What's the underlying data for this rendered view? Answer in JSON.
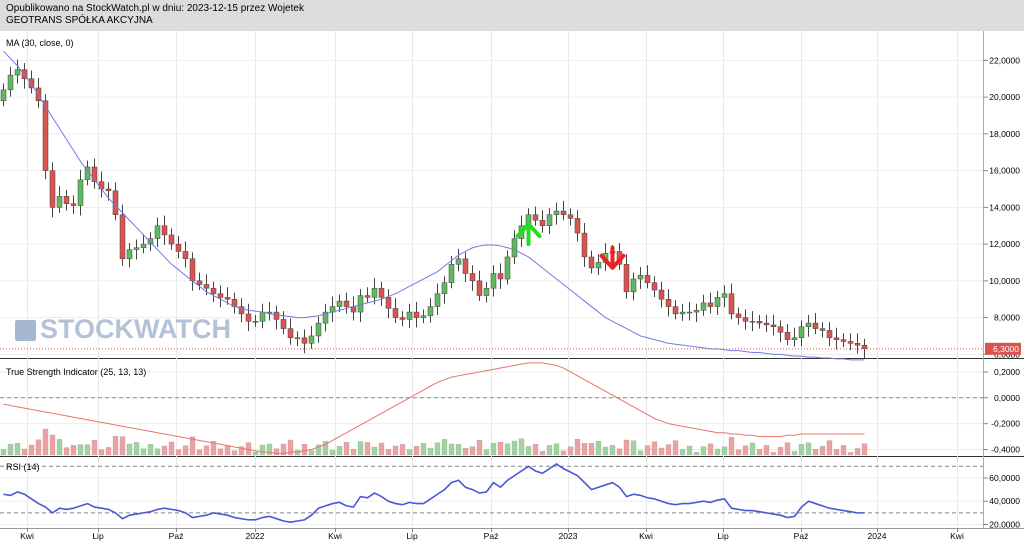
{
  "header": {
    "line1": "Opublikowano na StockWatch.pl w dniu: 2023-12-15 przez Wojetek",
    "line2": "GEOTRANS SPÓŁKA AKCYJNA"
  },
  "watermark": "STOCKWATCH",
  "colors": {
    "up": "#5fb95f",
    "down": "#d9534f",
    "ma": "#6f7ce0",
    "tsi": "#e8736a",
    "rsi": "#4a57d6",
    "last_price_badge": "#d9534f",
    "buy_arrow": "#22dd22",
    "sell_arrow": "#ee2222"
  },
  "chart_data": [
    {
      "type": "candlestick",
      "title": "MA (30, close, 0)",
      "ylim": [
        5.8,
        23.6
      ],
      "yticks": [
        "22,0000",
        "20,0000",
        "18,0000",
        "16,0000",
        "14,0000",
        "12,0000",
        "10,0000",
        "8,0000",
        "6,0000"
      ],
      "ytick_values": [
        22,
        20,
        18,
        16,
        14,
        12,
        10,
        8,
        6
      ],
      "last_price_label": "6,3000",
      "last_price": 6.3,
      "xlabels": [
        "Kwi",
        "Lip",
        "Paź",
        "2022",
        "Kwi",
        "Lip",
        "Paź",
        "2023",
        "Kwi",
        "Lip",
        "Paź",
        "2024",
        "Kwi"
      ],
      "weeks": 124,
      "closes": [
        20.4,
        21.2,
        21.5,
        21.0,
        20.5,
        19.8,
        16.0,
        14.0,
        14.6,
        14.2,
        14.1,
        15.5,
        16.2,
        15.4,
        15.0,
        14.9,
        13.6,
        11.2,
        11.7,
        11.8,
        12.0,
        12.3,
        13.0,
        12.5,
        12.0,
        11.6,
        11.2,
        10.0,
        9.8,
        9.6,
        9.3,
        9.1,
        9.0,
        8.6,
        8.2,
        7.8,
        7.8,
        8.3,
        8.3,
        7.9,
        7.4,
        6.9,
        6.9,
        6.6,
        7.0,
        7.7,
        8.3,
        8.6,
        8.9,
        8.6,
        8.3,
        9.2,
        9.1,
        9.6,
        9.1,
        8.5,
        8.0,
        7.9,
        8.3,
        8.0,
        8.1,
        8.6,
        9.3,
        9.9,
        10.9,
        11.2,
        10.4,
        10.0,
        9.2,
        9.6,
        10.4,
        10.1,
        11.3,
        12.3,
        13.0,
        13.6,
        13.3,
        13.0,
        13.6,
        13.8,
        13.6,
        13.4,
        12.6,
        11.3,
        10.7,
        11.0,
        11.5,
        11.6,
        10.9,
        9.4,
        10.1,
        10.3,
        9.9,
        9.5,
        9.0,
        8.6,
        8.2,
        8.3,
        8.3,
        8.4,
        8.8,
        8.6,
        9.1,
        9.3,
        8.2,
        8.0,
        7.8,
        7.8,
        7.7,
        7.6,
        7.5,
        7.2,
        6.8,
        6.9,
        7.5,
        7.7,
        7.4,
        7.3,
        6.9,
        6.8,
        6.7,
        6.6,
        6.5,
        6.3
      ],
      "series": [
        {
          "name": "MA (30, close, 0)",
          "values": [
            22.5,
            22.1,
            21.7,
            21.2,
            20.7,
            20.1,
            19.5,
            18.9,
            18.3,
            17.7,
            17.1,
            16.5,
            16.0,
            15.5,
            15.0,
            14.5,
            14.1,
            13.7,
            13.3,
            12.9,
            12.5,
            12.1,
            11.7,
            11.3,
            10.9,
            10.6,
            10.3,
            10.0,
            9.7,
            9.4,
            9.2,
            9.0,
            8.8,
            8.6,
            8.5,
            8.4,
            8.35,
            8.3,
            8.2,
            8.15,
            8.1,
            8.05,
            8.0,
            8.0,
            8.05,
            8.1,
            8.2,
            8.3,
            8.4,
            8.5,
            8.6,
            8.7,
            8.8,
            8.9,
            9.0,
            9.15,
            9.3,
            9.5,
            9.7,
            9.9,
            10.1,
            10.3,
            10.5,
            10.8,
            11.1,
            11.4,
            11.6,
            11.8,
            11.9,
            11.95,
            11.95,
            11.9,
            11.8,
            11.7,
            11.5,
            11.3,
            11.0,
            10.7,
            10.4,
            10.1,
            9.8,
            9.5,
            9.2,
            8.9,
            8.6,
            8.3,
            8.0,
            7.8,
            7.6,
            7.4,
            7.2,
            7.0,
            6.9,
            6.8,
            6.7,
            6.6,
            6.55,
            6.5,
            6.45,
            6.4,
            6.35,
            6.3,
            6.3,
            6.25,
            6.2,
            6.2,
            6.15,
            6.1,
            6.1,
            6.05,
            6.0,
            6.0,
            5.95,
            5.9,
            5.9,
            5.85,
            5.85,
            5.8,
            5.8,
            5.75,
            5.75,
            5.7,
            5.7,
            5.7
          ]
        }
      ],
      "signals": [
        {
          "type": "buy",
          "week": 75,
          "value": 12.6
        },
        {
          "type": "sell",
          "week": 87,
          "value": 11.2
        }
      ]
    },
    {
      "type": "line",
      "title": "True Strength Indicator (25, 13, 13)",
      "ylim": [
        -0.45,
        0.3
      ],
      "yticks": [
        "0,2000",
        "0,0000",
        "-0,2000",
        "-0,4000"
      ],
      "ytick_values": [
        0.2,
        0.0,
        -0.2,
        -0.4
      ],
      "series": [
        {
          "name": "True Strength Indicator (25, 13, 13)",
          "values": [
            -0.05,
            -0.06,
            -0.07,
            -0.08,
            -0.09,
            -0.1,
            -0.11,
            -0.12,
            -0.13,
            -0.14,
            -0.15,
            -0.16,
            -0.17,
            -0.18,
            -0.19,
            -0.2,
            -0.21,
            -0.22,
            -0.23,
            -0.24,
            -0.25,
            -0.26,
            -0.27,
            -0.28,
            -0.29,
            -0.3,
            -0.31,
            -0.32,
            -0.33,
            -0.34,
            -0.35,
            -0.36,
            -0.37,
            -0.38,
            -0.39,
            -0.4,
            -0.41,
            -0.42,
            -0.42,
            -0.43,
            -0.43,
            -0.42,
            -0.42,
            -0.41,
            -0.4,
            -0.38,
            -0.36,
            -0.33,
            -0.3,
            -0.27,
            -0.24,
            -0.21,
            -0.18,
            -0.15,
            -0.12,
            -0.09,
            -0.06,
            -0.03,
            0.0,
            0.03,
            0.06,
            0.09,
            0.12,
            0.14,
            0.16,
            0.17,
            0.18,
            0.19,
            0.2,
            0.21,
            0.22,
            0.23,
            0.24,
            0.25,
            0.26,
            0.27,
            0.27,
            0.27,
            0.26,
            0.25,
            0.23,
            0.2,
            0.17,
            0.14,
            0.11,
            0.08,
            0.05,
            0.02,
            -0.01,
            -0.04,
            -0.07,
            -0.1,
            -0.13,
            -0.16,
            -0.18,
            -0.2,
            -0.21,
            -0.22,
            -0.23,
            -0.24,
            -0.25,
            -0.26,
            -0.27,
            -0.27,
            -0.28,
            -0.28,
            -0.29,
            -0.29,
            -0.3,
            -0.3,
            -0.3,
            -0.3,
            -0.29,
            -0.29,
            -0.28,
            -0.28,
            -0.28,
            -0.28,
            -0.28,
            -0.28,
            -0.28,
            -0.28,
            -0.28,
            -0.28
          ]
        }
      ]
    },
    {
      "type": "line",
      "title": "RSI (14)",
      "ylim": [
        17,
        78
      ],
      "yticks": [
        "60,0000",
        "40,0000",
        "20,0000"
      ],
      "ytick_values": [
        60,
        40,
        20
      ],
      "series": [
        {
          "name": "RSI (14)",
          "values": [
            46,
            45,
            48,
            46,
            42,
            38,
            35,
            30,
            34,
            33,
            34,
            36,
            38,
            35,
            34,
            33,
            30,
            25,
            28,
            29,
            30,
            31,
            33,
            34,
            33,
            32,
            30,
            26,
            27,
            28,
            30,
            29,
            28,
            26,
            25,
            24,
            24,
            26,
            27,
            25,
            23,
            22,
            23,
            24,
            28,
            34,
            36,
            38,
            39,
            36,
            35,
            44,
            43,
            47,
            44,
            40,
            38,
            37,
            39,
            38,
            38,
            42,
            46,
            50,
            56,
            58,
            52,
            50,
            47,
            48,
            56,
            52,
            58,
            62,
            66,
            70,
            66,
            64,
            68,
            72,
            68,
            65,
            62,
            56,
            50,
            52,
            54,
            56,
            52,
            44,
            46,
            45,
            43,
            42,
            40,
            38,
            37,
            38,
            38,
            39,
            40,
            39,
            41,
            42,
            34,
            33,
            32,
            32,
            31,
            30,
            29,
            28,
            26,
            27,
            35,
            40,
            38,
            36,
            34,
            33,
            32,
            31,
            30,
            30
          ]
        }
      ]
    }
  ]
}
